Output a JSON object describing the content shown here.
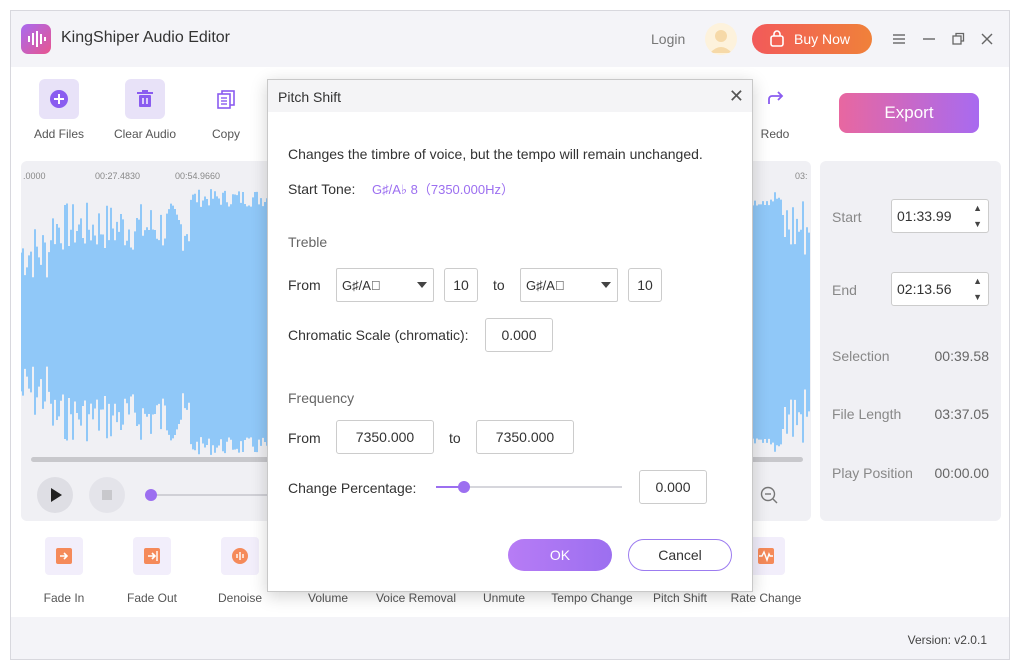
{
  "app": {
    "title": "KingShiper Audio Editor",
    "login": "Login",
    "buy_now": "Buy Now"
  },
  "toolbar": {
    "add_files": "Add Files",
    "clear_audio": "Clear Audio",
    "copy": "Copy",
    "redo": "Redo",
    "export": "Export"
  },
  "timeline": {
    "ticks": [
      ".0000",
      "00:27.4830",
      "00:54.9660",
      "03:"
    ]
  },
  "info": {
    "start_label": "Start",
    "start_value": "01:33.99",
    "end_label": "End",
    "end_value": "02:13.56",
    "selection_label": "Selection",
    "selection_value": "00:39.58",
    "file_length_label": "File Length",
    "file_length_value": "03:37.05",
    "play_position_label": "Play Position",
    "play_position_value": "00:00.00"
  },
  "tools": [
    "Fade In",
    "Fade Out",
    "Denoise",
    "Volume",
    "Voice Removal",
    "Unmute",
    "Tempo Change",
    "Pitch Shift",
    "Rate Change"
  ],
  "status": {
    "version": "Version: v2.0.1"
  },
  "dialog": {
    "title": "Pitch Shift",
    "description": "Changes the timbre of voice, but the tempo will remain unchanged.",
    "start_tone_label": "Start Tone:",
    "start_tone_value": "G♯/A♭ 8（7350.000Hz）",
    "treble_label": "Treble",
    "from_label": "From",
    "to_label": "to",
    "treble_from_note": "G♯/A\u0000",
    "treble_from_octave": "10",
    "treble_to_note": "G♯/A\u0000",
    "treble_to_octave": "10",
    "chromatic_label": "Chromatic Scale (chromatic):",
    "chromatic_value": "0.000",
    "frequency_label": "Frequency",
    "freq_from": "7350.000",
    "freq_to": "7350.000",
    "change_pct_label": "Change Percentage:",
    "change_pct_value": "0.000",
    "ok": "OK",
    "cancel": "Cancel"
  },
  "colors": {
    "accent": "#9c6ff0",
    "wave": "#90c8f8",
    "buy": "#f25a5a"
  }
}
